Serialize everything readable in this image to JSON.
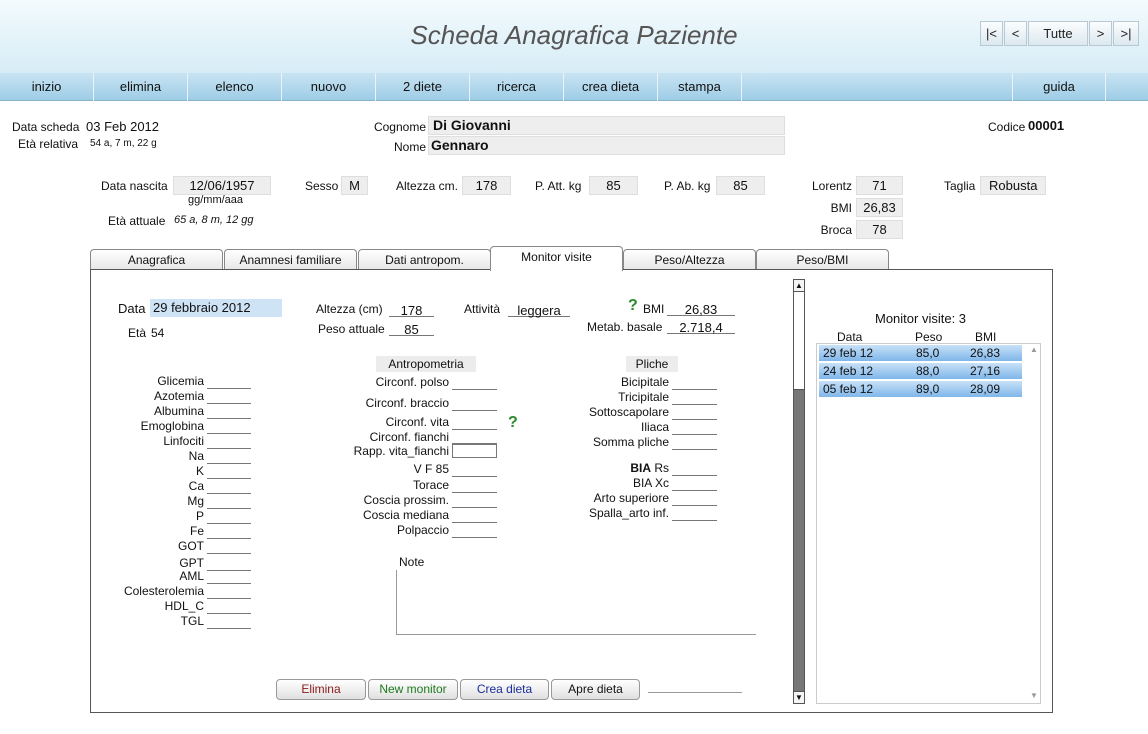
{
  "app": {
    "title": "Scheda Anagrafica Paziente",
    "nav": {
      "first": "|<",
      "prev": "<",
      "all": "Tutte",
      "next": ">",
      "last": ">|"
    }
  },
  "menu": {
    "items": [
      "inizio",
      "elimina",
      "elenco",
      "nuovo",
      "2 diete",
      "ricerca",
      "crea dieta",
      "stampa"
    ],
    "help": "guida"
  },
  "header_info": {
    "data_scheda_label": "Data scheda",
    "data_scheda": "03 Feb 2012",
    "eta_relativa_label": "Età relativa",
    "eta_relativa": "54 a, 7 m, 22 g",
    "cognome_label": "Cognome",
    "cognome": "Di Giovanni",
    "nome_label": "Nome",
    "nome": "Gennaro",
    "codice_label": "Codice",
    "codice": "00001"
  },
  "patient": {
    "data_nascita_label": "Data nascita",
    "data_nascita": "12/06/1957",
    "data_format": "gg/mm/aaa",
    "eta_attuale_label": "Età attuale",
    "eta_attuale": "65 a, 8 m, 12 gg",
    "sesso_label": "Sesso",
    "sesso": "M",
    "altezza_label": "Altezza cm.",
    "altezza": "178",
    "p_att_label": "P. Att. kg",
    "p_att": "85",
    "p_ab_label": "P. Ab. kg",
    "p_ab": "85",
    "lorentz_label": "Lorentz",
    "lorentz": "71",
    "bmi_label": "BMI",
    "bmi": "26,83",
    "broca_label": "Broca",
    "broca": "78",
    "taglia_label": "Taglia",
    "taglia": "Robusta"
  },
  "tabs": [
    "Anagrafica",
    "Anamnesi familiare",
    "Dati antropom.",
    "Monitor visite",
    "Peso/Altezza",
    "Peso/BMI"
  ],
  "visit": {
    "data_label": "Data",
    "data": "29 febbraio 2012",
    "eta_label": "Età",
    "eta": "54",
    "altezza_label": "Altezza (cm)",
    "altezza": "178",
    "peso_label": "Peso attuale",
    "peso": "85",
    "attivita_label": "Attività",
    "attivita": "leggera",
    "bmi_label": "BMI",
    "bmi": "26,83",
    "metab_label": "Metab. basale",
    "metab": "2.718,4",
    "help_glyph": "?"
  },
  "labs": [
    "Glicemia",
    "Azotemia",
    "Albumina",
    "Emoglobina",
    "Linfociti",
    "Na",
    "K",
    "Ca",
    "Mg",
    "P",
    "Fe",
    "GOT",
    "GPT",
    "AML",
    "Colesterolemia",
    "HDL_C",
    "TGL"
  ],
  "antropometria": {
    "title": "Antropometria",
    "fields": [
      "Circonf. polso",
      "Circonf. braccio",
      "Circonf. vita",
      "Circonf. fianchi",
      "Rapp. vita_fianchi",
      "V F  85",
      "Torace",
      "Coscia prossim.",
      "Coscia mediana",
      "Polpaccio"
    ]
  },
  "pliche": {
    "title": "Pliche",
    "fields": [
      "Bicipitale",
      "Tricipitale",
      "Sottoscapolare",
      "Iliaca",
      "Somma pliche"
    ],
    "bia_bold": "BIA",
    "bia_rs": "Rs",
    "bia_xc": "BIA Xc",
    "arto_sup": "Arto superiore",
    "spalla": "Spalla_arto inf."
  },
  "note_label": "Note",
  "buttons": {
    "elimina": "Elimina",
    "new_monitor": "New monitor",
    "crea_dieta": "Crea dieta",
    "apre_dieta": "Apre dieta"
  },
  "monitor": {
    "title": "Monitor visite: 3",
    "columns": [
      "Data",
      "Peso",
      "BMI"
    ],
    "rows": [
      {
        "data": "29 feb 12",
        "peso": "85,0",
        "bmi": "26,83"
      },
      {
        "data": "24 feb 12",
        "peso": "88,0",
        "bmi": "27,16"
      },
      {
        "data": "05 feb 12",
        "peso": "89,0",
        "bmi": "28,09"
      }
    ]
  },
  "colors": {
    "accent_green": "#2a8a2a",
    "row_blue": "#7fb6ea",
    "menu_blue": "#9ecde6"
  }
}
